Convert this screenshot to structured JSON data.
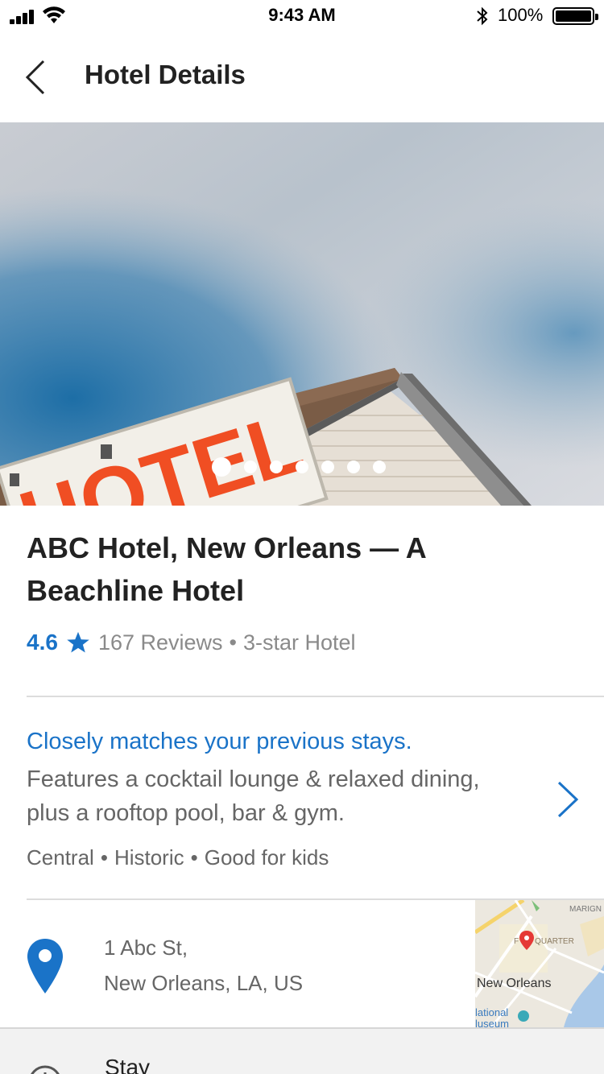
{
  "status": {
    "time": "9:43 AM",
    "battery_percent": "100%"
  },
  "header": {
    "title": "Hotel Details"
  },
  "gallery": {
    "sign_text": "HOTEL",
    "image_count": 7,
    "current_index": 0
  },
  "hotel": {
    "name": "ABC Hotel, New Orleans — A Beachline Hotel",
    "rating": "4.6",
    "reviews": "167 Reviews",
    "class": "3-star Hotel"
  },
  "summary": {
    "match_text": "Closely matches your previous stays.",
    "description": "Features a cocktail lounge & relaxed dining, plus a rooftop pool, bar & gym.",
    "tags": [
      "Central",
      "Historic",
      "Good for kids"
    ]
  },
  "address": {
    "line1": "1 Abc St,",
    "line2": "New Orleans, LA, US"
  },
  "map": {
    "labels": {
      "marigny": "MARIGN",
      "quarter": "F  CH QUARTER",
      "city": "New Orleans",
      "museum1": "lational",
      "museum2": "luseum"
    }
  },
  "stay": {
    "label": "Stay"
  },
  "colors": {
    "accent": "#1a73c8",
    "text_primary": "#222222",
    "text_secondary": "#666666",
    "sign_orange": "#f04e23"
  }
}
